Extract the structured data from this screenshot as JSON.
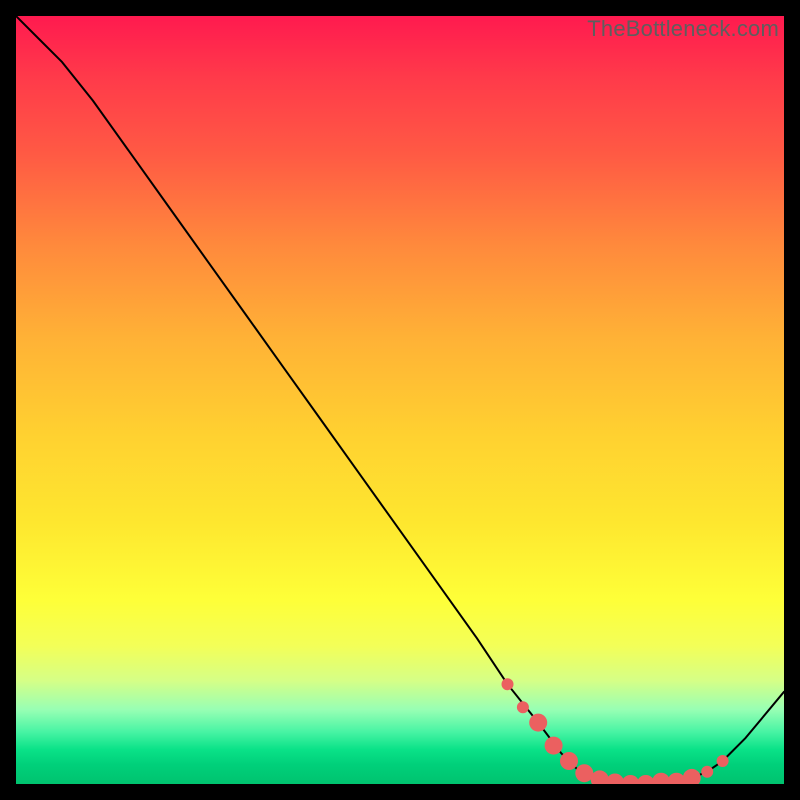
{
  "watermark": "TheBottleneck.com",
  "chart_data": {
    "type": "line",
    "title": "",
    "xlabel": "",
    "ylabel": "",
    "xlim": [
      0,
      100
    ],
    "ylim": [
      0,
      100
    ],
    "series": [
      {
        "name": "bottleneck-curve",
        "x": [
          0,
          3,
          6,
          10,
          15,
          20,
          25,
          30,
          35,
          40,
          45,
          50,
          55,
          60,
          64,
          68,
          71,
          73,
          75,
          77,
          80,
          83,
          86,
          88,
          90,
          92,
          95,
          100
        ],
        "y": [
          100,
          97,
          94,
          89,
          82,
          75,
          68,
          61,
          54,
          47,
          40,
          33,
          26,
          19,
          13,
          8,
          4,
          2,
          1,
          0.4,
          0,
          0,
          0.3,
          0.8,
          1.6,
          3,
          6,
          12
        ]
      }
    ],
    "markers": {
      "name": "highlight-dots",
      "x": [
        64,
        66,
        68,
        70,
        72,
        74,
        76,
        78,
        80,
        82,
        84,
        86,
        88,
        90,
        92
      ],
      "y": [
        13,
        10,
        8,
        5,
        3,
        1.4,
        0.6,
        0.2,
        0,
        0,
        0.3,
        0.3,
        0.8,
        1.6,
        3
      ]
    },
    "gradient_stops_pct": [
      0,
      8,
      18,
      30,
      42,
      55,
      66,
      76,
      82,
      86.5,
      90.3,
      93.2,
      95.5,
      97.5,
      100
    ],
    "gradient_colors": [
      "#ff1a4f",
      "#ff3a4a",
      "#ff5a44",
      "#ff8a3c",
      "#ffb236",
      "#ffd230",
      "#fee72f",
      "#feff38",
      "#f3ff58",
      "#d6ff86",
      "#98ffb4",
      "#48f4a4",
      "#0ae288",
      "#00d07a",
      "#00c36f"
    ]
  }
}
